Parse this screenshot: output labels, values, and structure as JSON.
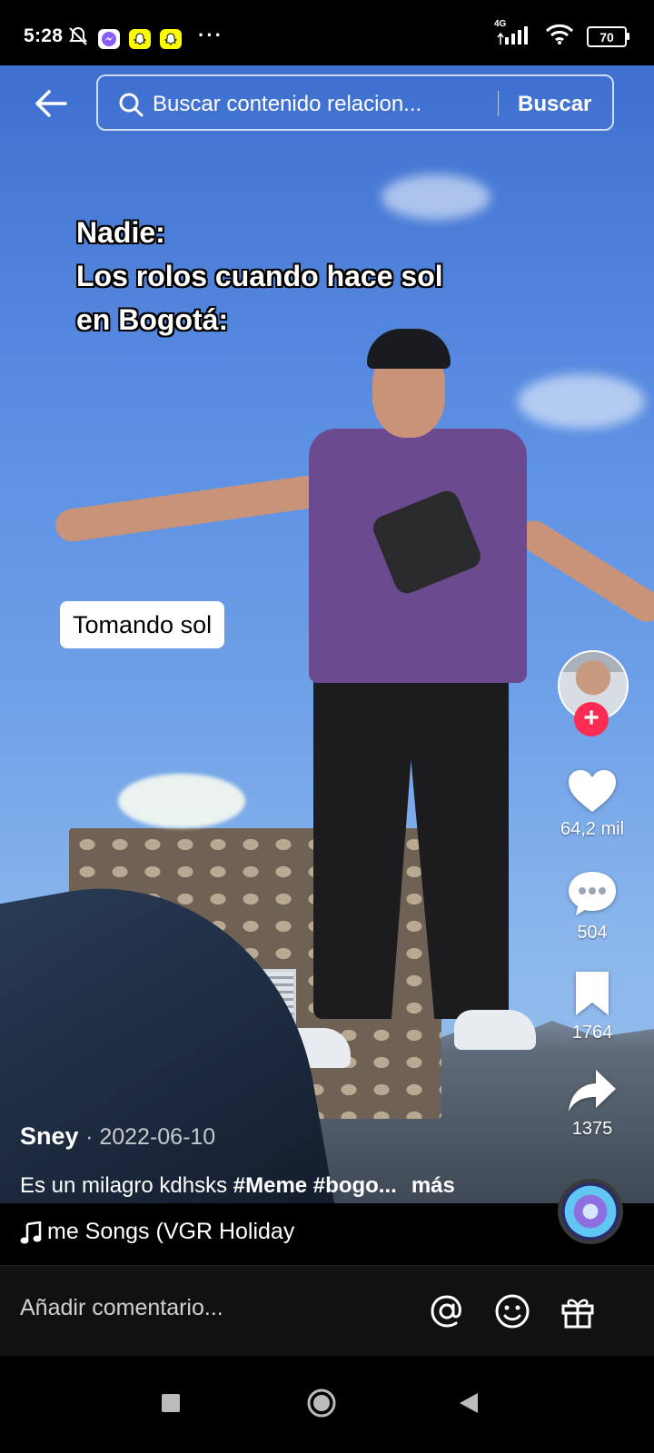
{
  "status_bar": {
    "time": "5:28",
    "dots": "···",
    "network": "4G",
    "battery": "70",
    "icons": [
      "bell-off-icon",
      "messenger-icon",
      "snapchat-icon",
      "snapchat-icon",
      "signal-icon",
      "wifi-icon",
      "battery-icon"
    ]
  },
  "search": {
    "placeholder": "Buscar contenido relacion...",
    "button_label": "Buscar"
  },
  "video": {
    "overlay_text": [
      "Nadie:",
      "Los rolos cuando hace sol",
      "en Bogotá:"
    ],
    "sticker_text": "Tomando sol"
  },
  "rail": {
    "likes": "64,2 mil",
    "comments": "504",
    "saves": "1764",
    "shares": "1375",
    "follow_label": "+"
  },
  "post": {
    "author": "Sney",
    "date": "· 2022-06-10",
    "caption_text": "Es un milagro kdhsks ",
    "caption_tags": "#Meme #bogo...",
    "more_label": "más",
    "music": "me Songs (VGR Holiday"
  },
  "comment_bar": {
    "placeholder": "Añadir comentario..."
  },
  "colors": {
    "accent": "#fe2c55",
    "background": "#000000"
  }
}
